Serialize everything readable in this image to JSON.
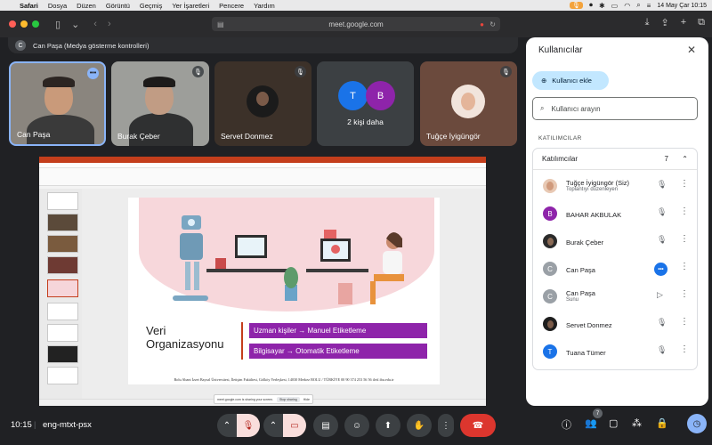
{
  "menubar": {
    "app": "Safari",
    "items": [
      "Dosya",
      "Düzen",
      "Görüntü",
      "Geçmiş",
      "Yer İşaretleri",
      "Pencere",
      "Yardım"
    ],
    "datetime": "14 May Çar  10:15"
  },
  "browser": {
    "url": "meet.google.com"
  },
  "presenter_strip": {
    "avatar_letter": "C",
    "text": "Can Paşa (Medya gösterme kontrolleri)"
  },
  "tiles": [
    {
      "name": "Can Paşa"
    },
    {
      "name": "Burak Çeber"
    },
    {
      "name": "Servet Donmez"
    },
    {
      "name": "2 kişi daha",
      "letters": [
        "T",
        "B"
      ]
    },
    {
      "name": "Tuğçe İyigüngör"
    }
  ],
  "slide": {
    "title_line1": "Veri",
    "title_line2": "Organizasyonu",
    "pill1": "Uzman kişiler → Manuel Etiketleme",
    "pill2": "Bilgisayar → Otomatik Etiketleme",
    "footer": "Bolu Abant İzzet Baysal Üniversitesi, İletişim Fakültesi, Gölköy Yerleşkesi, 14030 Merkez BOLU / TÜRKİYE  00 90 374 253 56 56  iletf.ibu.edu.tr",
    "sharing_text": "meet.google.com is sharing your screen.",
    "stop_label": "Stop sharing",
    "hide_label": "Hide"
  },
  "panel": {
    "title": "Kullanıcılar",
    "add_label": "Kullanıcı ekle",
    "search_placeholder": "Kullanıcı arayın",
    "section": "KATILIMCILAR",
    "group_label": "Katılımcılar",
    "group_count": "7",
    "participants": [
      {
        "name": "Tuğçe İyigüngör (Siz)",
        "sub": "Toplantıyı düzenleyen",
        "letter": "",
        "color": "#e8c9b4"
      },
      {
        "name": "BAHAR AKBULAK",
        "sub": "",
        "letter": "B",
        "color": "#8e24aa"
      },
      {
        "name": "Burak Çeber",
        "sub": "",
        "letter": "",
        "color": "#4a4a4a"
      },
      {
        "name": "Can Paşa",
        "sub": "",
        "letter": "C",
        "color": "#9aa0a6"
      },
      {
        "name": "Can Paşa",
        "sub": "Sunu",
        "letter": "C",
        "color": "#9aa0a6"
      },
      {
        "name": "Servet Donmez",
        "sub": "",
        "letter": "",
        "color": "#2a2a2a"
      },
      {
        "name": "Tuana Tümer",
        "sub": "",
        "letter": "T",
        "color": "#1a73e8"
      }
    ]
  },
  "bottombar": {
    "time": "10:15",
    "meeting_code": "eng-mtxt-psx",
    "people_badge": "7"
  }
}
